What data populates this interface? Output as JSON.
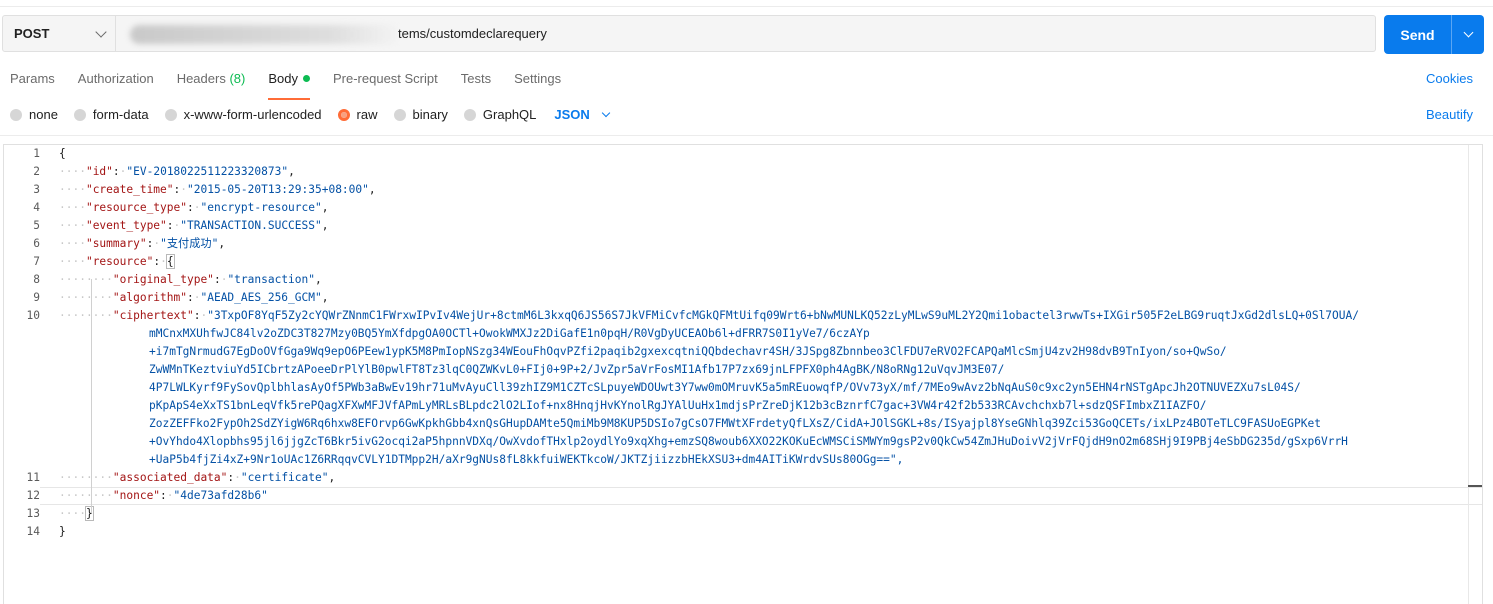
{
  "request": {
    "method": "POST",
    "url_visible": "tems/customdeclarequery",
    "send_label": "Send"
  },
  "tabs": [
    {
      "label": "Params"
    },
    {
      "label": "Authorization"
    },
    {
      "label": "Headers",
      "count": "(8)"
    },
    {
      "label": "Body"
    },
    {
      "label": "Pre-request Script"
    },
    {
      "label": "Tests"
    },
    {
      "label": "Settings"
    }
  ],
  "cookies_label": "Cookies",
  "body_options": {
    "modes": [
      "none",
      "form-data",
      "x-www-form-urlencoded",
      "raw",
      "binary",
      "GraphQL"
    ],
    "selected": "raw",
    "language": "JSON",
    "beautify_label": "Beautify"
  },
  "editor": {
    "line_numbers": [
      "1",
      "2",
      "3",
      "4",
      "5",
      "6",
      "7",
      "8",
      "9",
      "10",
      "11",
      "12",
      "13",
      "14"
    ],
    "id_key": "\"id\"",
    "id_val": "\"EV-2018022511223320873\"",
    "create_time_key": "\"create_time\"",
    "create_time_val": "\"2015-05-20T13:29:35+08:00\"",
    "resource_type_key": "\"resource_type\"",
    "resource_type_val": "\"encrypt-resource\"",
    "event_type_key": "\"event_type\"",
    "event_type_val": "\"TRANSACTION.SUCCESS\"",
    "summary_key": "\"summary\"",
    "summary_val": "\"支付成功\"",
    "resource_key": "\"resource\"",
    "original_type_key": "\"original_type\"",
    "original_type_val": "\"transaction\"",
    "algorithm_key": "\"algorithm\"",
    "algorithm_val": "\"AEAD_AES_256_GCM\"",
    "ciphertext_key": "\"ciphertext\"",
    "ciphertext_lines": [
      "\"3TxpOF8YqF5Zy2cYQWrZNnmC1FWrxwIPvIv4WejUr+8ctmM6L3kxqQ6JS56S7JkVFMiCvfcMGkQFMtUifq09Wrt6+bNwMUNLKQ52zLyMLwS9uML2Y2Qmi1obactel3rwwTs+IXGir505F2eLBG9ruqtJxGd2dlsLQ+0Sl7OUA/",
      "mMCnxMXUhfwJC84lv2oZDC3T827Mzy0BQ5YmXfdpgOA0OCTl+OwokWMXJz2DiGafE1n0pqH/R0VgDyUCEAOb6l+dFRR7S0I1yVe7/6czAYp",
      "+i7mTgNrmudG7EgDoOVfGga9Wq9epO6PEew1ypK5M8PmIopNSzg34WEouFhOqvPZfi2paqib2gxexcqtniQQbdechavr4SH/3JSpg8Zbnnbeo3ClFDU7eRVO2FCAPQaMlcSmjU4zv2H98dvB9TnIyon/so+QwSo/",
      "ZwWMnTKeztviuYd5ICbrtzAPoeeDrPlYlB0pwlFT8Tz3lqC0QZWKvL0+FIj0+9P+2/JvZpr5aVrFosMI1Afb17P7zx69jnLFPFX0ph4AgBK/N8oRNg12uVqvJM3E07/",
      "4P7LWLKyrf9FySovQplbhlasAyOf5PWb3aBwEv19hr71uMvAyuCll39zhIZ9M1CZTcSLpuyeWDOUwt3Y7ww0mOMruvK5a5mREuowqfP/OVv73yX/mf/7MEo9wAvz2bNqAuS0c9xc2yn5EHN4rNSTgApcJh2OTNUVEZXu7sL04S/",
      "pKpApS4eXxTS1bnLeqVfk5rePQagXFXwMFJVfAPmLyMRLsBLpdc2lO2LIof+nx8HnqjHvKYnolRgJYAlUuHx1mdjsPrZreDjK12b3cBznrfC7gac+3VW4r42f2b533RCAvchchxb7l+sdzQSFImbxZ1IAZFO/",
      "ZozZEFFko2FypOh2SdZYigW6Rq6hxw8EFOrvp6GwKpkhGbb4xnQsGHupDAMte5QmiMb9M8KUP5DSIo7gCsO7FMWtXFrdetyQfLXsZ/CidA+JOlSGKL+8s/ISyajpl8YseGNhlq39Zci53GoQCETs/ixLPz4BOTeTLC9FASUoEGPKet",
      "+OvYhdo4Xlopbhs95jl6jjgZcT6Bkr5ivG2ocqi2aP5hpnnVDXq/OwXvdofTHxlp2oydlYo9xqXhg+emzSQ8woub6XXO22KOKuEcWMSCiSMWYm9gsP2v0QkCw54ZmJHuDoivV2jVrFQjdH9nO2m68SHj9I9PBj4eSbDG235d/gSxp6VrrH",
      "+UaP5b4fjZi4xZ+9Nr1oUAc1Z6RRqqvCVLY1DTMpp2H/aXr9gNUs8fL8kkfuiWEKTkcoW/JKTZjiizzbHEkXSU3+dm4AITiKWrdvSUs80OGg==\","
    ],
    "associated_data_key": "\"associated_data\"",
    "associated_data_val": "\"certificate\"",
    "nonce_key": "\"nonce\"",
    "nonce_val": "\"4de73afd28b6\""
  },
  "colors": {
    "accent": "#097bed",
    "active_tab": "#ff6c37",
    "json_key": "#a31515",
    "json_string": "#0451a5",
    "count_green": "#0cbb52"
  }
}
